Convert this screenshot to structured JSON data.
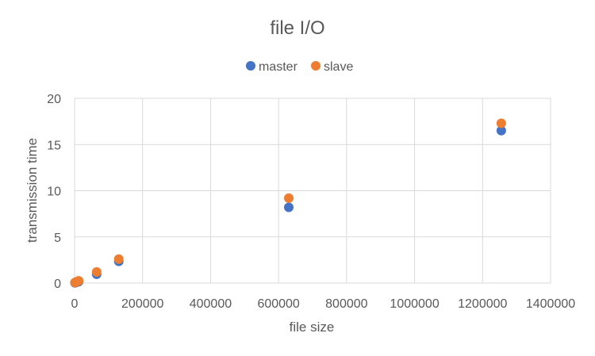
{
  "chart_data": {
    "type": "scatter",
    "title": "file I/O",
    "xlabel": "file size",
    "ylabel": "transmission time",
    "xlim": [
      0,
      1400000
    ],
    "ylim": [
      0,
      20
    ],
    "x_ticks": [
      "0",
      "200000",
      "400000",
      "600000",
      "800000",
      "1000000",
      "1200000",
      "1400000"
    ],
    "y_ticks": [
      "0",
      "5",
      "10",
      "15",
      "20"
    ],
    "grid": true,
    "legend_position": "top",
    "series": [
      {
        "name": "master",
        "color": "#4472c4",
        "points": [
          {
            "x": 1000,
            "y": 0.02
          },
          {
            "x": 3000,
            "y": 0.05
          },
          {
            "x": 6000,
            "y": 0.08
          },
          {
            "x": 12000,
            "y": 0.15
          },
          {
            "x": 65000,
            "y": 0.95
          },
          {
            "x": 130000,
            "y": 2.35
          },
          {
            "x": 630000,
            "y": 8.2
          },
          {
            "x": 1255000,
            "y": 16.5
          }
        ]
      },
      {
        "name": "slave",
        "color": "#ed7d31",
        "points": [
          {
            "x": 1000,
            "y": 0.05
          },
          {
            "x": 3000,
            "y": 0.1
          },
          {
            "x": 6000,
            "y": 0.15
          },
          {
            "x": 12000,
            "y": 0.25
          },
          {
            "x": 65000,
            "y": 1.2
          },
          {
            "x": 130000,
            "y": 2.6
          },
          {
            "x": 630000,
            "y": 9.2
          },
          {
            "x": 1255000,
            "y": 17.3
          }
        ]
      }
    ]
  }
}
